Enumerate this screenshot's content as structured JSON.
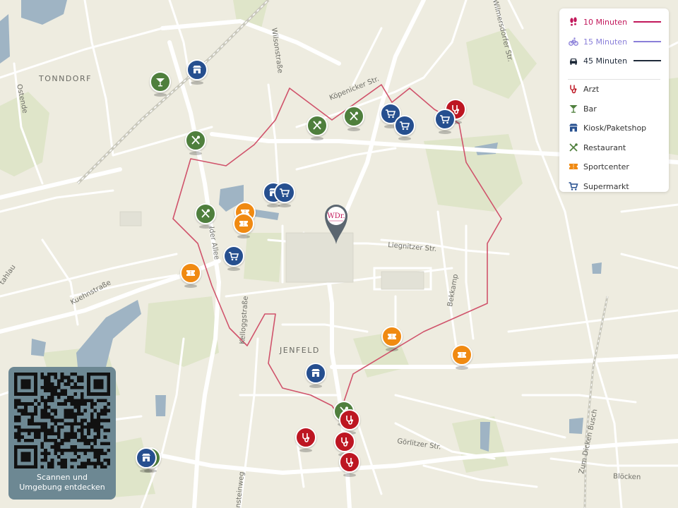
{
  "map": {
    "districts": [
      "TONNDORF",
      "JENFELD"
    ],
    "streets": [
      "Ostende",
      "Wilsonstraße",
      "Köpenicker Str.",
      "Wilmersdorfer Str.",
      "Liegnitzer Str.",
      "Kuehnstraße",
      "Kelloggstraße",
      "lder Allee",
      "Bekkamp",
      "Görlitzer Str.",
      "Zum Dicken Busch",
      "Blöcken",
      "nsteinweg",
      "tahlau"
    ],
    "location_marker": {
      "logo_text": "WDr."
    },
    "colors": {
      "background": "#eeece0",
      "road": "#ffffff",
      "park": "#dfe5c9",
      "water": "#9fb4c4",
      "isochrone": "#d0536b"
    }
  },
  "legend": {
    "routes": [
      {
        "label": "10 Minuten",
        "icon": "walking-icon",
        "color": "#c2185b"
      },
      {
        "label": "15 Minuten",
        "icon": "bicycle-icon",
        "color": "#8a7fd9"
      },
      {
        "label": "45 Minuten",
        "icon": "car-icon",
        "color": "#1f2a3a"
      }
    ],
    "categories": [
      {
        "label": "Arzt",
        "icon": "stethoscope-icon",
        "color": "#bd1622"
      },
      {
        "label": "Bar",
        "icon": "cocktail-icon",
        "color": "#4f7f3d"
      },
      {
        "label": "Kiosk/Paketshop",
        "icon": "shop-icon",
        "color": "#264f8f"
      },
      {
        "label": "Restaurant",
        "icon": "cutlery-icon",
        "color": "#4f7f3d"
      },
      {
        "label": "Sportcenter",
        "icon": "ticket-icon",
        "color": "#f08a12"
      },
      {
        "label": "Supermarkt",
        "icon": "cart-icon",
        "color": "#264f8f"
      }
    ]
  },
  "qr": {
    "caption_line1": "Scannen und",
    "caption_line2": "Umgebung entdecken"
  }
}
